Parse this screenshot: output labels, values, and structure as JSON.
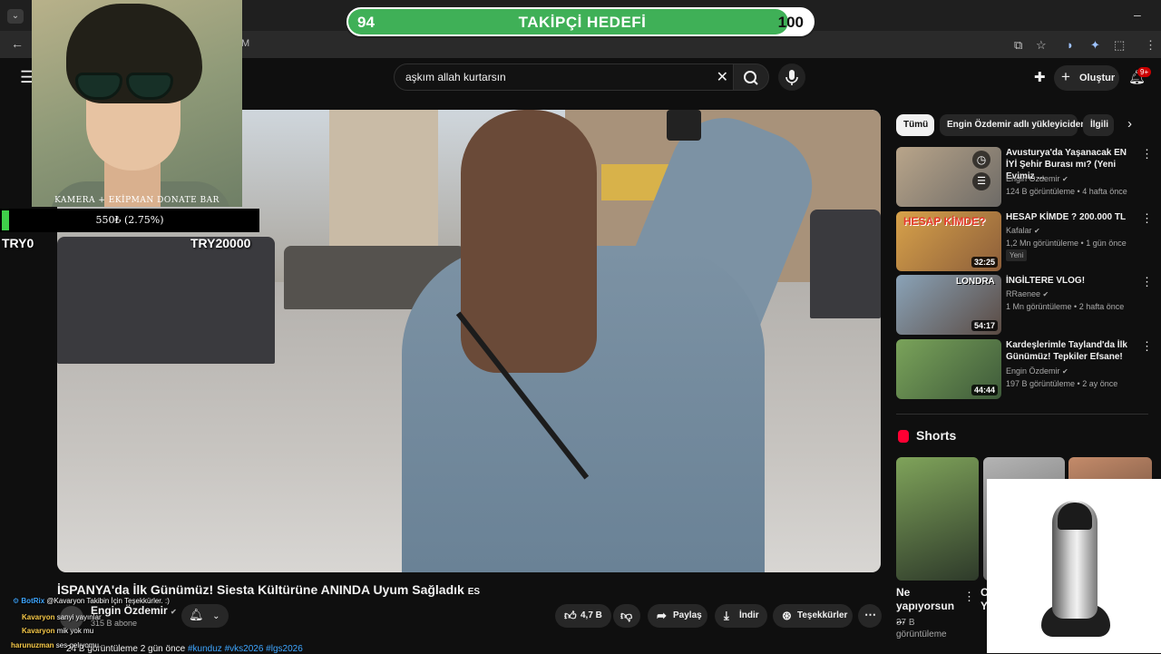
{
  "goal": {
    "start": "94",
    "title": "TAKİPÇİ HEDEFİ",
    "end": "100",
    "progress": 0.94,
    "fill_color": "#3fb057"
  },
  "browser": {
    "url_fragment": "M"
  },
  "header": {
    "search_value": "aşkım allah kurtarsın",
    "create_label": "Oluştur",
    "notif_badge": "9+"
  },
  "video": {
    "title": "İSPANYA'da İlk Günümüz! Siesta Kültürüne ANINDA Uyum Sağladık",
    "title_suffix": "ES",
    "channel": "Engin Özdemir",
    "subscribers": "315 B abone",
    "likes": "4,7 B",
    "share_label": "Paylaş",
    "download_label": "İndir",
    "thanks_label": "Teşekkürler",
    "description_meta": "24 B görüntüleme  2 gün önce",
    "description_tags": "#kunduz #vks2026 #lgs2026"
  },
  "sidebar": {
    "chips": [
      "Tümü",
      "Engin Özdemir adlı yükleyiciden",
      "İlgili"
    ],
    "recommendations": [
      {
        "title": "Avusturya'da Yaşanacak EN İYİ Şehir Burası mı? (Yeni Evimiz ...",
        "channel": "Engin Özdemir",
        "meta": "124 B görüntüleme • 4 hafta önce",
        "duration": "",
        "badge": ""
      },
      {
        "title": "HESAP KİMDE ? 200.000 TL",
        "channel": "Kafalar",
        "meta": "1,2 Mn görüntüleme • 1 gün önce",
        "duration": "32:25",
        "badge": "Yeni",
        "thumb_text": "HESAP KİMDE?"
      },
      {
        "title": "İNGİLTERE VLOG!",
        "channel": "RRaenee",
        "meta": "1 Mn görüntüleme • 2 hafta önce",
        "duration": "54:17",
        "badge": "",
        "thumb_text": "LONDRA"
      },
      {
        "title": "Kardeşlerimle Tayland'da İlk Günümüz! Tepkiler Efsane!",
        "channel": "Engin Özdemir",
        "meta": "197 B görüntüleme • 2 ay önce",
        "duration": "44:44",
        "badge": ""
      }
    ],
    "shorts_title": "Shorts",
    "short1": {
      "title": "Ne yapıyorsun ...",
      "meta": "37 B görüntüleme"
    },
    "short2_fragment": "C\nY"
  },
  "overlay": {
    "avatar_label": "KAMERA + EKİPMAN DONATE BAR",
    "donate_amount": "550₺ (2.75%)",
    "donate_progress": 0.0275,
    "donate_min": "TRY0",
    "donate_max": "TRY20000"
  },
  "chat": [
    {
      "user": "BotRix",
      "text": "@Kavaryon Takibin İçin Teşekkürler. :)",
      "color": "#3ea6ff"
    },
    {
      "user": "Kavaryon",
      "text": "sanyi yayınlar",
      "color": "#f7c948"
    },
    {
      "user": "Kavaryon",
      "text": "mik yok mu",
      "color": "#f7c948"
    },
    {
      "user": "harunuzman",
      "text": "ses gelıyomu",
      "color": "#f7c948"
    }
  ]
}
